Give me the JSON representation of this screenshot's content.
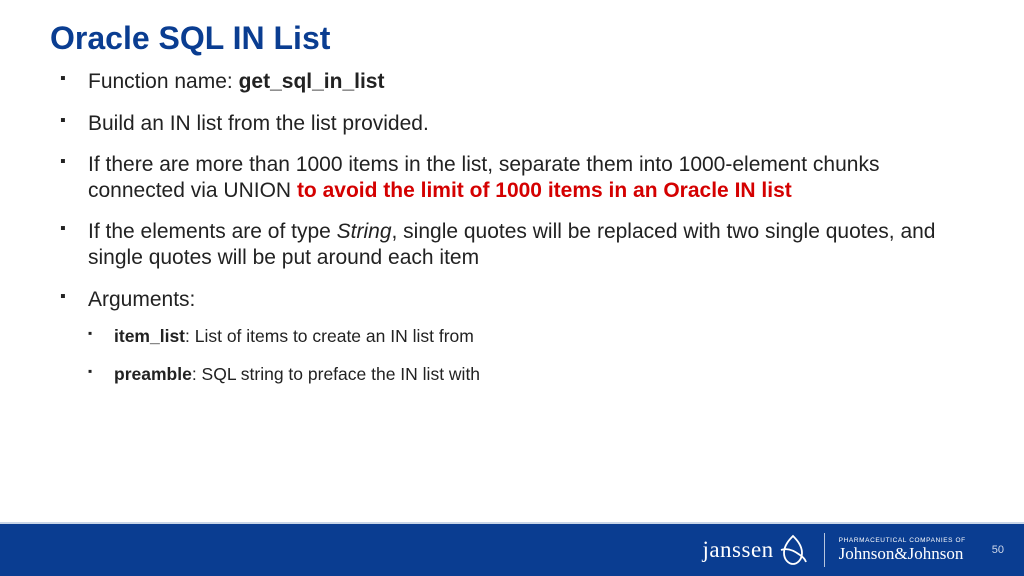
{
  "title": "Oracle SQL IN List",
  "bullets": {
    "b1_prefix": "Function name: ",
    "b1_bold": "get_sql_in_list",
    "b2": "Build an IN list from the list provided.",
    "b3_prefix": "If there are more than 1000 items in the list, separate them into 1000-element chunks connected via UNION ",
    "b3_red": "to avoid the limit of 1000 items in an Oracle IN list",
    "b4_prefix": "If the elements are of type ",
    "b4_italic": "String",
    "b4_suffix": ", single quotes will be replaced with two single quotes, and single quotes will be put around each item",
    "b5": "Arguments:",
    "sub1_bold": "item_list",
    "sub1_rest": ": List of items to create an IN list from",
    "sub2_bold": "preamble",
    "sub2_rest": ": SQL string to preface the IN list with"
  },
  "footer": {
    "brand1": "janssen",
    "brand2_tag": "PHARMACEUTICAL COMPANIES OF",
    "brand2_script": "Johnson&Johnson",
    "page": "50"
  }
}
